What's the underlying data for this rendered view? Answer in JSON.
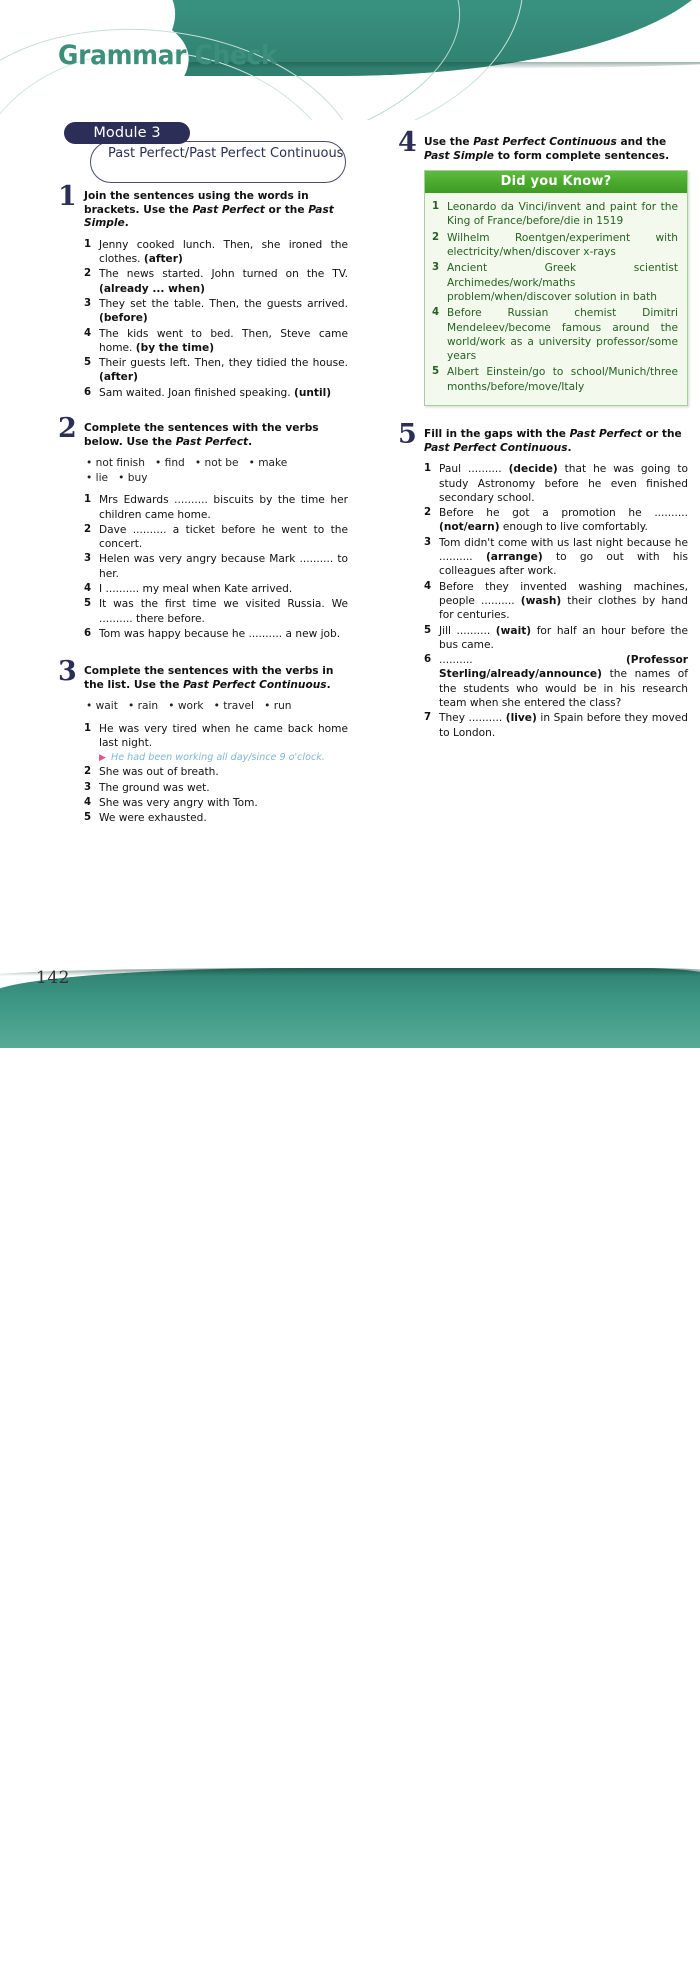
{
  "page": {
    "title": "Grammar Check",
    "number": "142"
  },
  "module": {
    "badge": "Module 3",
    "topic": "Past Perfect/Past Perfect Continuous"
  },
  "exercises": [
    {
      "number": "1",
      "rubric_parts": [
        {
          "t": "Join the sentences using the words in brackets. Use the ",
          "i": false
        },
        {
          "t": "Past Perfect",
          "i": true
        },
        {
          "t": " or the ",
          "i": false
        },
        {
          "t": "Past Simple",
          "i": true
        },
        {
          "t": ".",
          "i": false
        }
      ],
      "items": [
        [
          {
            "t": "Jenny cooked lunch. Then, she ironed the clothes. ",
            "b": false
          },
          {
            "t": "(after)",
            "b": true
          }
        ],
        [
          {
            "t": "The news started. John turned on the TV. ",
            "b": false
          },
          {
            "t": "(already ... when)",
            "b": true
          }
        ],
        [
          {
            "t": "They set the table. Then, the guests arrived. ",
            "b": false
          },
          {
            "t": "(before)",
            "b": true
          }
        ],
        [
          {
            "t": "The kids went to bed. Then, Steve came home. ",
            "b": false
          },
          {
            "t": "(by the time)",
            "b": true
          }
        ],
        [
          {
            "t": "Their guests left. Then, they tidied the house. ",
            "b": false
          },
          {
            "t": "(after)",
            "b": true
          }
        ],
        [
          {
            "t": "Sam waited. Joan finished speaking. ",
            "b": false
          },
          {
            "t": "(until)",
            "b": true
          }
        ]
      ]
    },
    {
      "number": "2",
      "rubric_parts": [
        {
          "t": "Complete the sentences with the verbs below. Use the ",
          "i": false
        },
        {
          "t": "Past Perfect",
          "i": true
        },
        {
          "t": ".",
          "i": false
        }
      ],
      "wordbank_lines": [
        [
          "not finish",
          "find",
          "not be",
          "make"
        ],
        [
          "lie",
          "buy"
        ]
      ],
      "items": [
        [
          {
            "t": "Mrs Edwards .......... biscuits by the time her children came home.",
            "b": false
          }
        ],
        [
          {
            "t": "Dave .......... a ticket before he went to the concert.",
            "b": false
          }
        ],
        [
          {
            "t": "Helen was very angry because Mark .......... to her.",
            "b": false
          }
        ],
        [
          {
            "t": "I .......... my meal when Kate arrived.",
            "b": false
          }
        ],
        [
          {
            "t": "It was the first time we visited Russia. We .......... there before.",
            "b": false
          }
        ],
        [
          {
            "t": "Tom was happy because he .......... a new job.",
            "b": false
          }
        ]
      ]
    },
    {
      "number": "3",
      "rubric_parts": [
        {
          "t": "Complete the sentences with the verbs in the list. Use the ",
          "i": false
        },
        {
          "t": "Past Perfect Continuous",
          "i": true
        },
        {
          "t": ".",
          "i": false
        }
      ],
      "wordbank_lines": [
        [
          "wait",
          "rain",
          "work",
          "travel",
          "run"
        ]
      ],
      "items": [
        [
          {
            "t": "He was very tired when he came back home last night.",
            "b": false
          }
        ],
        [
          {
            "t": "She was out of breath.",
            "b": false
          }
        ],
        [
          {
            "t": "The ground was wet.",
            "b": false
          }
        ],
        [
          {
            "t": "She was very angry with Tom.",
            "b": false
          }
        ],
        [
          {
            "t": "We were exhausted.",
            "b": false
          }
        ]
      ],
      "example_answer": "He had been working all day/since 9 o'clock.",
      "example_arrow": "▶"
    },
    {
      "number": "4",
      "rubric_parts": [
        {
          "t": "Use the ",
          "i": false
        },
        {
          "t": "Past Perfect Continuous",
          "i": true
        },
        {
          "t": " and the ",
          "i": false
        },
        {
          "t": "Past Simple",
          "i": true
        },
        {
          "t": " to form complete sentences.",
          "i": false
        }
      ],
      "box": {
        "header": "Did you Know?",
        "items": [
          [
            {
              "t": "Leonardo da Vinci/invent and paint for the King of France/before/die in 1519",
              "b": false
            }
          ],
          [
            {
              "t": "Wilhelm Roentgen/experiment with electricity/when/discover x-rays",
              "b": false
            }
          ],
          [
            {
              "t": "Ancient Greek scientist Archimedes/work/maths problem/when/discover solution in bath",
              "b": false
            }
          ],
          [
            {
              "t": "Before Russian chemist Dimitri Mendeleev/become famous around the world/work as a university professor/some years",
              "b": false
            }
          ],
          [
            {
              "t": "Albert Einstein/go to school/Munich/three months/before/move/Italy",
              "b": false
            }
          ]
        ]
      }
    },
    {
      "number": "5",
      "rubric_parts": [
        {
          "t": "Fill in the gaps with the ",
          "i": false
        },
        {
          "t": "Past Perfect",
          "i": true
        },
        {
          "t": " or the ",
          "i": false
        },
        {
          "t": "Past Perfect Continuous",
          "i": true
        },
        {
          "t": ".",
          "i": false
        }
      ],
      "items": [
        [
          {
            "t": "Paul .......... ",
            "b": false
          },
          {
            "t": "(decide)",
            "b": true
          },
          {
            "t": " that he was going to study Astronomy before he even finished secondary school.",
            "b": false
          }
        ],
        [
          {
            "t": "Before he got a promotion he .......... ",
            "b": false
          },
          {
            "t": "(not/earn)",
            "b": true
          },
          {
            "t": " enough to live comfortably.",
            "b": false
          }
        ],
        [
          {
            "t": "Tom didn't come with us last night because he .......... ",
            "b": false
          },
          {
            "t": "(arrange)",
            "b": true
          },
          {
            "t": " to go out with his colleagues after work.",
            "b": false
          }
        ],
        [
          {
            "t": "Before they invented washing machines, people .......... ",
            "b": false
          },
          {
            "t": "(wash)",
            "b": true
          },
          {
            "t": " their clothes by hand for centuries.",
            "b": false
          }
        ],
        [
          {
            "t": "Jill .......... ",
            "b": false
          },
          {
            "t": "(wait)",
            "b": true
          },
          {
            "t": " for half an hour before the bus came.",
            "b": false
          }
        ],
        [
          {
            "t": ".......... ",
            "b": false
          },
          {
            "t": "(Professor Sterling/already/announce)",
            "b": true
          },
          {
            "t": " the names of the students who would be in his research team when she entered the class?",
            "b": false
          }
        ],
        [
          {
            "t": "They .......... ",
            "b": false
          },
          {
            "t": "(live)",
            "b": true
          },
          {
            "t": " in Spain before they moved to London.",
            "b": false
          }
        ]
      ]
    }
  ],
  "colors": {
    "header_teal": "#38907e",
    "title_green": "#3d8f7c",
    "module_navy": "#2c2e57",
    "dyk_green": "#49a92c",
    "dyk_bg": "#f4f9ee",
    "answer_blue": "#7fb8d4",
    "answer_arrow_pink": "#e0558f"
  }
}
